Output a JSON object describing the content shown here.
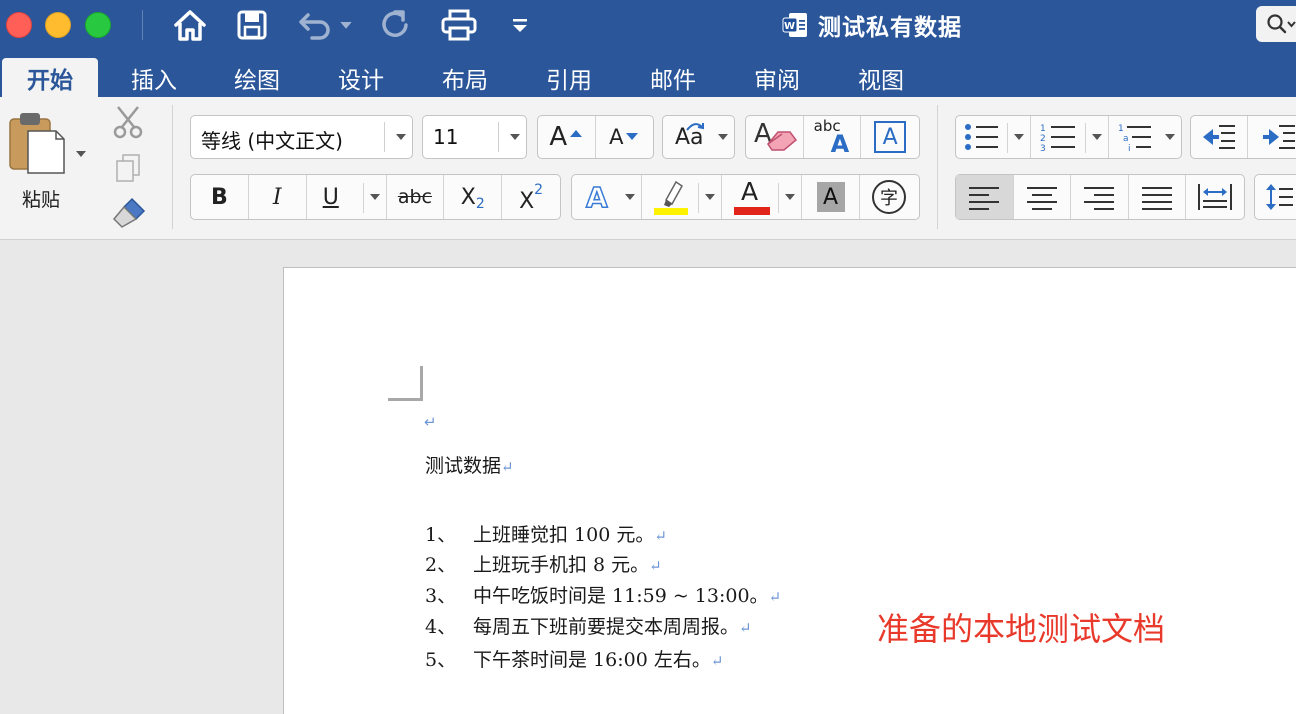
{
  "window": {
    "title": "测试私有数据"
  },
  "tabs": [
    {
      "label": "开始",
      "active": true
    },
    {
      "label": "插入"
    },
    {
      "label": "绘图"
    },
    {
      "label": "设计"
    },
    {
      "label": "布局"
    },
    {
      "label": "引用"
    },
    {
      "label": "邮件"
    },
    {
      "label": "审阅"
    },
    {
      "label": "视图"
    }
  ],
  "ribbon": {
    "paste_label": "粘贴",
    "font_name": "等线 (中文正文)",
    "font_size": "11",
    "bold_label": "B",
    "italic_label": "I",
    "underline_label": "U",
    "strike_label": "abc",
    "subscript_label": "X",
    "subscript_sub": "2",
    "superscript_label": "X",
    "superscript_sup": "2",
    "grow_label": "A",
    "shrink_label": "A",
    "case_label": "Aa",
    "clear_label": "A",
    "abc_label": "abc",
    "abc_a_label": "A",
    "border_a_label": "A",
    "text_effect_label": "A",
    "font_color_label": "A",
    "shade_a_label": "A",
    "enclose_label": "字"
  },
  "colors": {
    "brand": "#2b579a",
    "highlight": "#fff200",
    "font_color": "#e1251b",
    "annotation": "#e8392b"
  },
  "document": {
    "title_line": "测试数据",
    "items": [
      {
        "num": "1、",
        "text": "上班睡觉扣 100 元。"
      },
      {
        "num": "2、",
        "text": "上班玩手机扣 8 元。"
      },
      {
        "num": "3、",
        "text": "中午吃饭时间是 11:59 ~ 13:00。"
      },
      {
        "num": "4、",
        "text": "每周五下班前要提交本周周报。"
      },
      {
        "num": "5、",
        "text": "下午茶时间是 16:00  左右。"
      }
    ],
    "paragraph_mark": "↵"
  },
  "annotation": "准备的本地测试文档"
}
